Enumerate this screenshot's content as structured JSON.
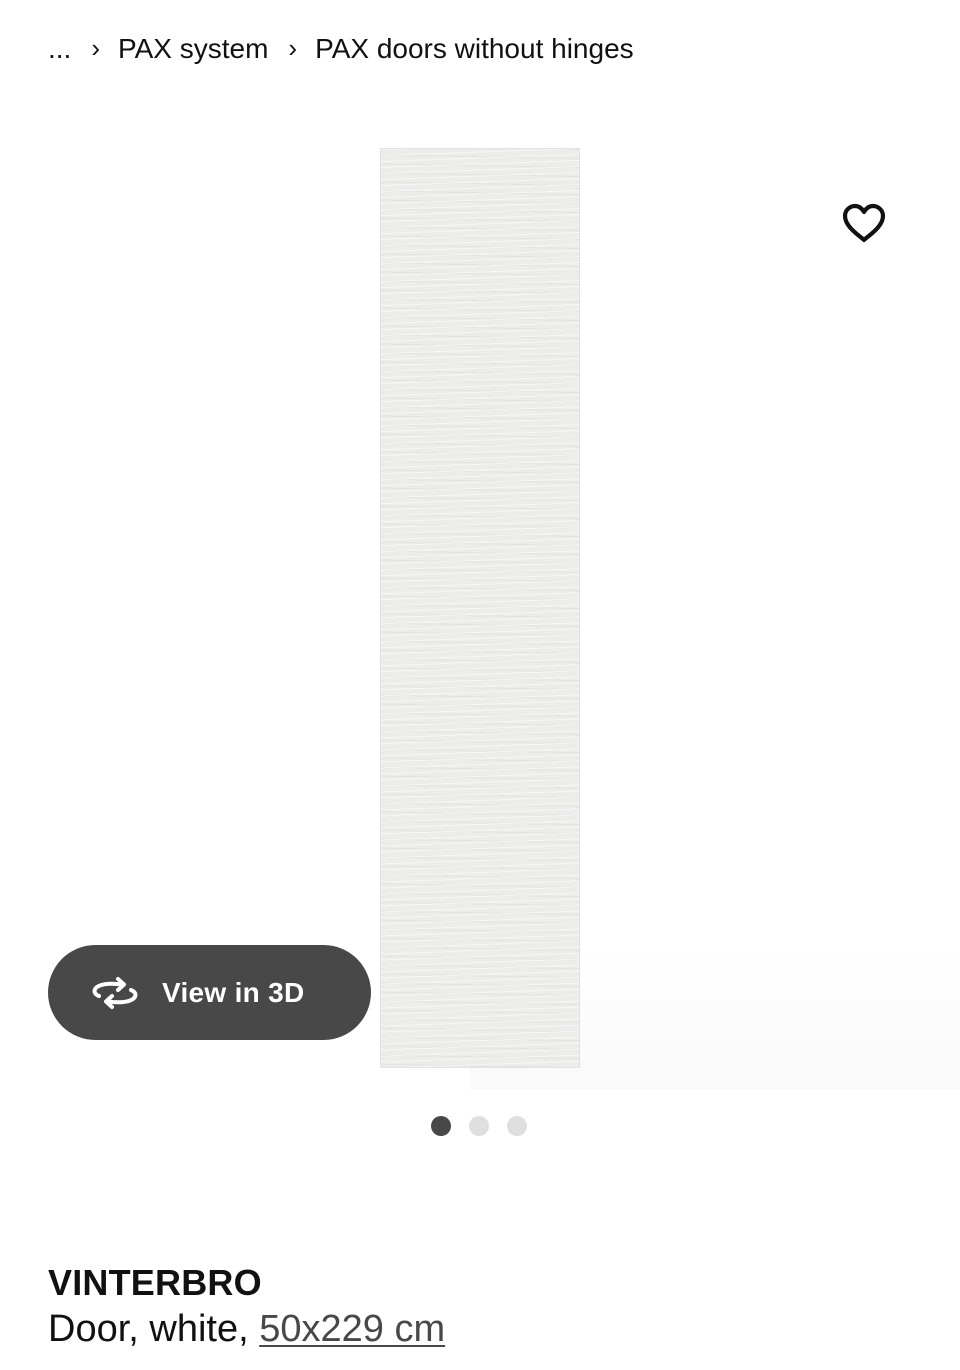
{
  "breadcrumb": {
    "ellipsis": "...",
    "separator": "›",
    "items": [
      {
        "label": "PAX system"
      },
      {
        "label": "PAX doors without hinges"
      }
    ]
  },
  "gallery": {
    "image_alt": "VINTERBRO door, white",
    "favourite_icon": "heart-outline-icon",
    "view3d": {
      "label": "View in 3D",
      "icon": "rotate-3d-icon"
    },
    "dots": {
      "count": 3,
      "active_index": 0
    }
  },
  "product": {
    "name": "VINTERBRO",
    "description_prefix": "Door, white, ",
    "size": "50x229 cm"
  },
  "colors": {
    "button_bg": "#484848",
    "dot_inactive": "#dfdfdf",
    "text": "#111111"
  }
}
